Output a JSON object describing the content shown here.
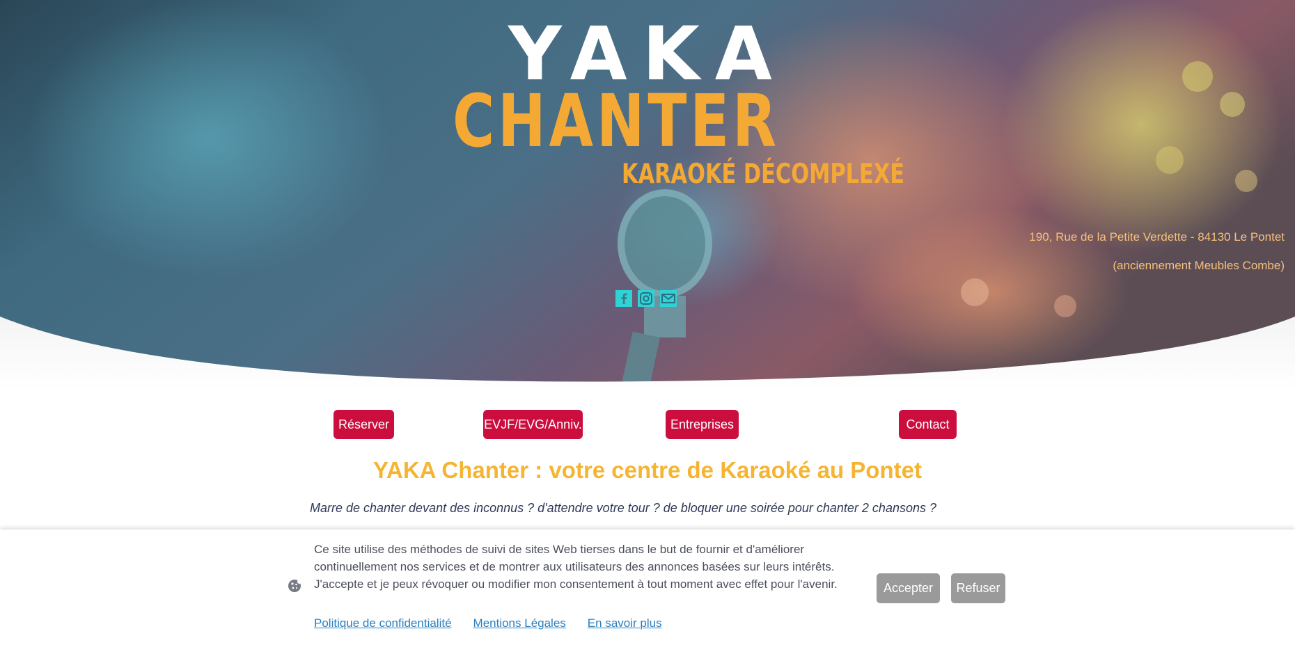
{
  "hero": {
    "logo": {
      "line1": "YAKA",
      "line2": "CHANTER"
    },
    "tagline": "KARAOKÉ DÉCOMPLEXÉ",
    "address_line1": "190, Rue de la Petite Verdette - 84130 Le Pontet",
    "address_line2": "(anciennement Meubles Combe)",
    "socials": [
      "facebook-icon",
      "instagram-icon",
      "mail-icon"
    ]
  },
  "nav": {
    "reserver": "Réserver",
    "evjf": "EVJF/EVG/Anniv.",
    "entreprises": "Entreprises",
    "contact": "Contact"
  },
  "main": {
    "headline": "YAKA Chanter : votre centre de Karaoké au Pontet",
    "intro": "Marre de chanter devant des inconnus ? d'attendre votre tour ? de bloquer une soirée pour chanter 2 chansons ?"
  },
  "cookie_banner": {
    "text": "Ce site utilise des méthodes de suivi de sites Web tierses dans le but de fournir et d'améliorer continuellement nos services et de montrer aux utilisateurs des annonces basées sur leurs intérêts. J'accepte et je peux révoquer ou modifier mon consentement à tout moment avec effet pour l'avenir.",
    "links": [
      "Politique de confidentialité",
      "Mentions Légales",
      "En savoir plus"
    ],
    "accept": "Accepter",
    "refuse": "Refuser"
  },
  "colors": {
    "brand_orange": "#f5a935",
    "nav_red": "#cc0e3e",
    "social_cyan": "#2fd3d6",
    "cookie_button_gray": "#9a9a9a",
    "link_blue": "#2a7fbf"
  }
}
